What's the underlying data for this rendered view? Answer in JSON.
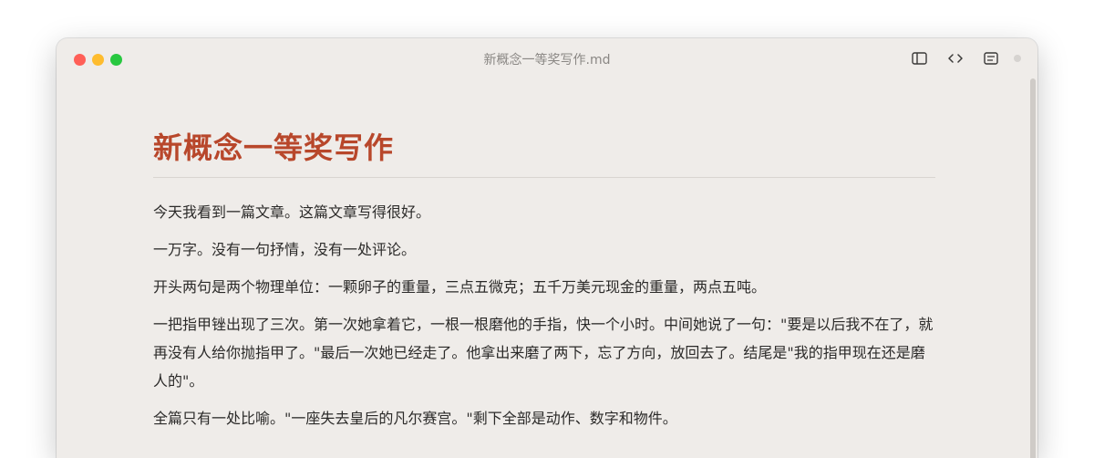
{
  "window": {
    "title": "新概念一等奖写作.md"
  },
  "toolbar": {
    "icons": [
      "sidebar-icon",
      "code-view-icon",
      "outline-icon",
      "status-dot"
    ]
  },
  "document": {
    "heading": "新概念一等奖写作",
    "paragraphs": [
      "今天我看到一篇文章。这篇文章写得很好。",
      "一万字。没有一句抒情，没有一处评论。",
      "开头两句是两个物理单位：一颗卵子的重量，三点五微克；五千万美元现金的重量，两点五吨。",
      "一把指甲锉出现了三次。第一次她拿着它，一根一根磨他的手指，快一个小时。中间她说了一句：\"要是以后我不在了，就再没有人给你抛指甲了。\"最后一次她已经走了。他拿出来磨了两下，忘了方向，放回去了。结尾是\"我的指甲现在还是磨人的\"。",
      "全篇只有一处比喻。\"一座失去皇后的凡尔赛宫。\"剩下全部是动作、数字和物件。"
    ]
  },
  "colors": {
    "heading": "#b8472b",
    "background": "#efece9",
    "text": "#2b2a29"
  }
}
